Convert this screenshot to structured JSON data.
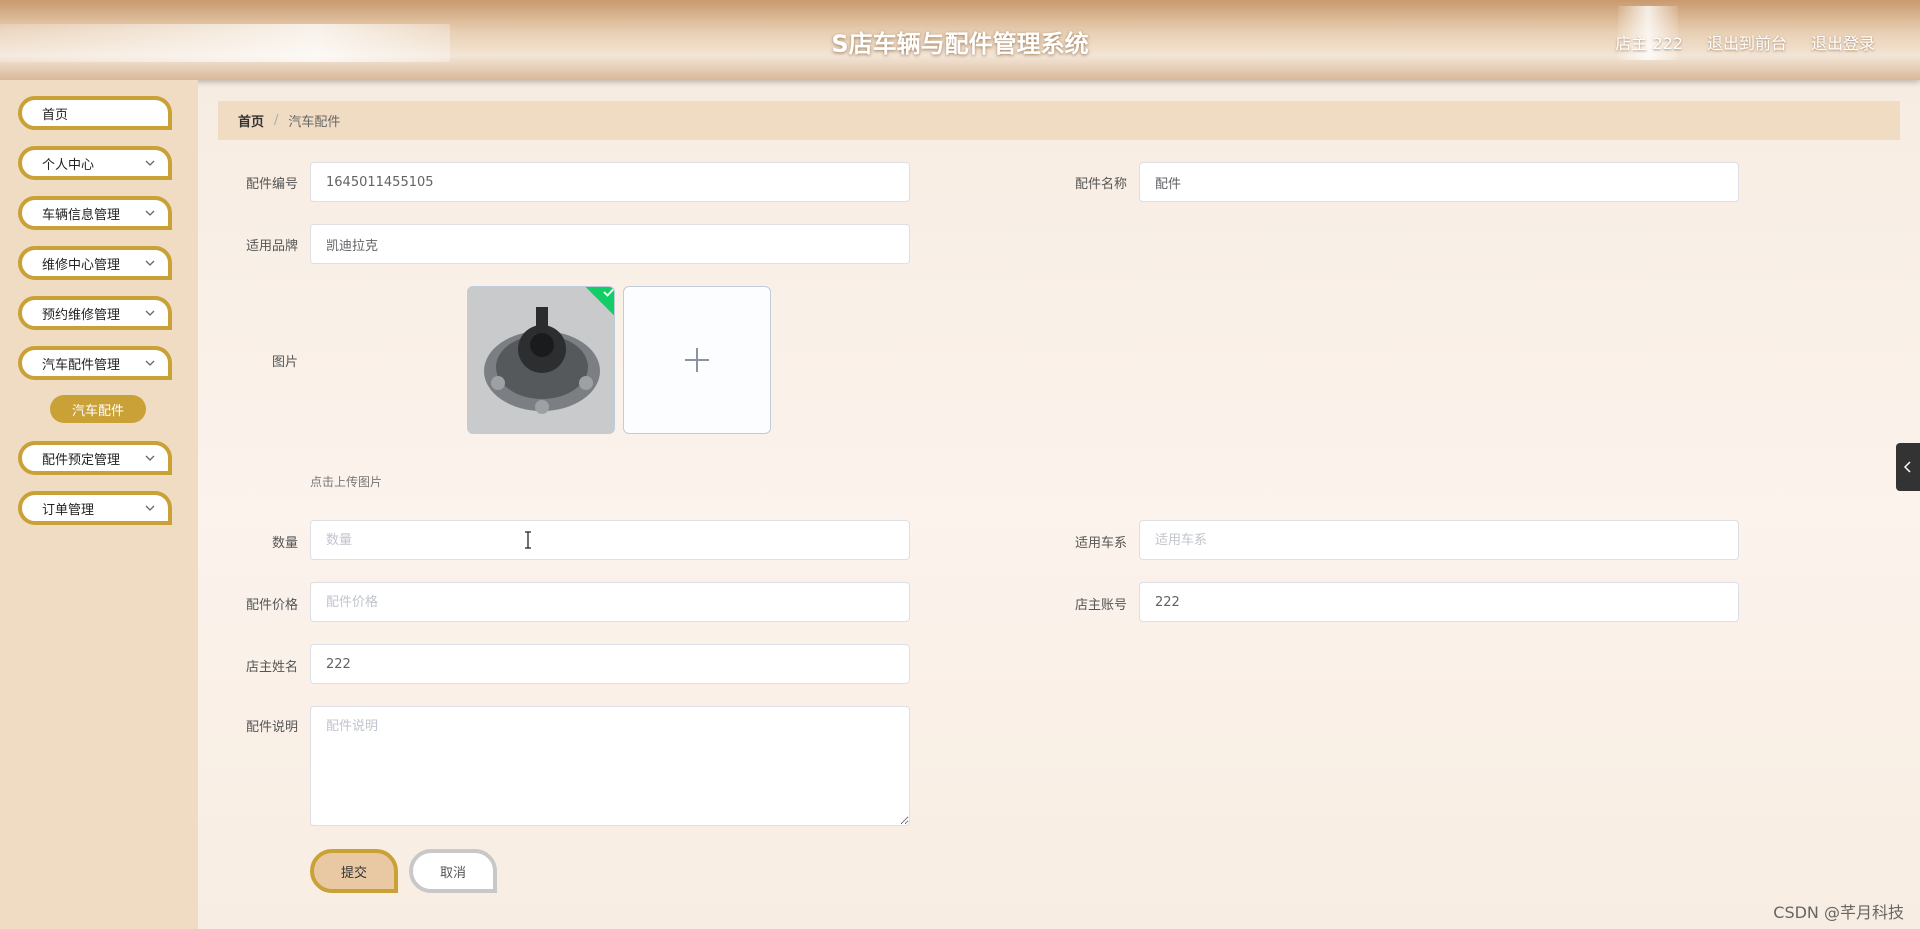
{
  "header": {
    "title": "S店车辆与配件管理系统",
    "user_label": "店主 222",
    "frontend_link": "退出到前台",
    "logout_link": "退出登录"
  },
  "sidebar": {
    "items": [
      {
        "label": "首页"
      },
      {
        "label": "个人中心"
      },
      {
        "label": "车辆信息管理"
      },
      {
        "label": "维修中心管理"
      },
      {
        "label": "预约维修管理"
      },
      {
        "label": "汽车配件管理"
      },
      {
        "label": "配件预定管理"
      },
      {
        "label": "订单管理"
      }
    ],
    "active_sub_item": "汽车配件"
  },
  "breadcrumb": {
    "home": "首页",
    "separator": "/",
    "current": "汽车配件"
  },
  "form": {
    "part_no": {
      "label": "配件编号",
      "value": "1645011455105"
    },
    "part_name": {
      "label": "配件名称",
      "value": "配件"
    },
    "brand": {
      "label": "适用品牌",
      "value": "凯迪拉克"
    },
    "image": {
      "label": "图片",
      "hint": "点击上传图片"
    },
    "quantity": {
      "label": "数量",
      "placeholder": "数量"
    },
    "car_series": {
      "label": "适用车系",
      "placeholder": "适用车系"
    },
    "price": {
      "label": "配件价格",
      "placeholder": "配件价格"
    },
    "owner_account": {
      "label": "店主账号",
      "value": "222"
    },
    "owner_name": {
      "label": "店主姓名",
      "value": "222"
    },
    "description": {
      "label": "配件说明",
      "placeholder": "配件说明"
    },
    "submit_label": "提交",
    "cancel_label": "取消"
  },
  "watermark": "CSDN @芊月科技",
  "colors": {
    "accent_gold": "#c9a137",
    "sidebar_bg": "#efdcc3",
    "breadcrumb_bg": "#f0dcc3",
    "success_green": "#13ce66"
  }
}
